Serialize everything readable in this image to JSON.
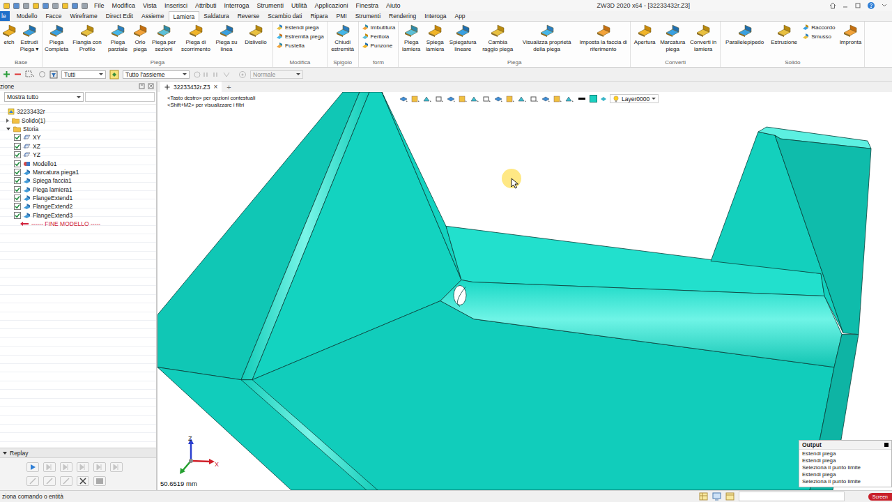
{
  "window": {
    "title": "ZW3D 2020 x64 - [32233432r.Z3]"
  },
  "menu": [
    "File",
    "Modifica",
    "Vista",
    "Inserisci",
    "Attributi",
    "Interroga",
    "Strumenti",
    "Utilità",
    "Applicazioni",
    "Finestra",
    "Aiuto"
  ],
  "ribbon_tabs": [
    {
      "label": "le",
      "kind": "file",
      "selected": false
    },
    {
      "label": "Modello",
      "kind": "tab",
      "selected": false
    },
    {
      "label": "Facce",
      "kind": "tab",
      "selected": false
    },
    {
      "label": "Wireframe",
      "kind": "tab",
      "selected": false
    },
    {
      "label": "Direct Edit",
      "kind": "tab",
      "selected": false
    },
    {
      "label": "Assieme",
      "kind": "tab",
      "selected": false
    },
    {
      "label": "Lamiera",
      "kind": "tab",
      "selected": true
    },
    {
      "label": "Saldatura",
      "kind": "tab",
      "selected": false
    },
    {
      "label": "Reverse",
      "kind": "tab",
      "selected": false
    },
    {
      "label": "Scambio dati",
      "kind": "tab",
      "selected": false
    },
    {
      "label": "Ripara",
      "kind": "tab",
      "selected": false
    },
    {
      "label": "PMI",
      "kind": "tab",
      "selected": false
    },
    {
      "label": "Strumenti",
      "kind": "tab",
      "selected": false
    },
    {
      "label": "Rendering",
      "kind": "tab",
      "selected": false
    },
    {
      "label": "Interoga",
      "kind": "tab",
      "selected": false
    },
    {
      "label": "App",
      "kind": "tab",
      "selected": false
    }
  ],
  "ribbon_groups": [
    {
      "label": "Base",
      "items": [
        {
          "label": "etch",
          "kind": "large"
        },
        {
          "label": "Estrudi Piega ▾",
          "kind": "large"
        }
      ]
    },
    {
      "label": "Piega",
      "items": [
        {
          "label": "Piega Completa",
          "kind": "large"
        },
        {
          "label": "Flangia con Profilo",
          "kind": "large"
        },
        {
          "label": "Piega parziale",
          "kind": "large"
        },
        {
          "label": "Orlo piega",
          "kind": "large"
        },
        {
          "label": "Piega per sezioni",
          "kind": "large"
        },
        {
          "label": "Piega di scorrimento",
          "kind": "large"
        },
        {
          "label": "Piega su linea",
          "kind": "large"
        },
        {
          "label": "Dislivello",
          "kind": "large"
        }
      ]
    },
    {
      "label": "Modifica",
      "items": [
        {
          "label": "Estendi piega",
          "kind": "small"
        },
        {
          "label": "Estremità piega",
          "kind": "small"
        },
        {
          "label": "Fustella",
          "kind": "small"
        }
      ]
    },
    {
      "label": "Spigolo",
      "items": [
        {
          "label": "Chiudi estremità",
          "kind": "large"
        }
      ]
    },
    {
      "label": "form",
      "items": [
        {
          "label": "Imbutitura",
          "kind": "small"
        },
        {
          "label": "Feritoia",
          "kind": "small"
        },
        {
          "label": "Punzone",
          "kind": "small"
        }
      ]
    },
    {
      "label": "Piega",
      "items": [
        {
          "label": "Piega lamiera",
          "kind": "large"
        },
        {
          "label": "Spiega lamiera",
          "kind": "large"
        },
        {
          "label": "Spiegatura lineare",
          "kind": "large"
        },
        {
          "label": "Cambia raggio piega",
          "kind": "large"
        },
        {
          "label": "Visualizza proprietà della piega",
          "kind": "large"
        },
        {
          "label": "Imposta la faccia di riferimento",
          "kind": "large"
        }
      ]
    },
    {
      "label": "Converti",
      "items": [
        {
          "label": "Apertura",
          "kind": "large"
        },
        {
          "label": "Marcatura piega",
          "kind": "large"
        },
        {
          "label": "Converti in lamiera",
          "kind": "large"
        }
      ]
    },
    {
      "label": "Solido",
      "items": [
        {
          "label": "Parallelepipedo",
          "kind": "large"
        },
        {
          "label": "Estrusione",
          "kind": "large"
        },
        {
          "label": "Raccordo",
          "kind": "small"
        },
        {
          "label": "Smusso",
          "kind": "small"
        },
        {
          "label": "Impronta",
          "kind": "large"
        }
      ]
    }
  ],
  "toolbar": {
    "filters": [
      {
        "label": "Tutti",
        "disabled": false
      },
      {
        "label": "Tutto l'assieme",
        "disabled": false
      },
      {
        "label": "Normale",
        "disabled": true
      }
    ]
  },
  "left_panel": {
    "title": "zione",
    "filter": "Mostra tutto",
    "tree": {
      "label": "32233432r",
      "children": [
        {
          "label": "Solido(1)",
          "kind": "folder",
          "expanded": false,
          "children": []
        },
        {
          "label": "Storia",
          "kind": "folder",
          "expanded": true,
          "children": [
            {
              "label": "XY",
              "kind": "plane",
              "checked": true
            },
            {
              "label": "XZ",
              "kind": "plane",
              "checked": true
            },
            {
              "label": "YZ",
              "kind": "plane",
              "checked": true
            },
            {
              "label": "Modello1",
              "kind": "model",
              "checked": true
            },
            {
              "label": "Marcatura piega1",
              "kind": "feature",
              "checked": true
            },
            {
              "label": "Spiega faccia1",
              "kind": "feature",
              "checked": true
            },
            {
              "label": "Piega lamiera1",
              "kind": "feature",
              "checked": true
            },
            {
              "label": "FlangeExtend1",
              "kind": "feature",
              "checked": true
            },
            {
              "label": "FlangeExtend2",
              "kind": "feature",
              "checked": true
            },
            {
              "label": "FlangeExtend3",
              "kind": "feature",
              "checked": true
            },
            {
              "label": "------ FINE MODELLO -----",
              "kind": "end",
              "checked": false
            }
          ]
        }
      ]
    }
  },
  "replay": {
    "title": "Replay"
  },
  "document_tabs": [
    {
      "label": "32233432r.Z3",
      "selected": true,
      "close": "×"
    }
  ],
  "new_tab": "+",
  "viewport": {
    "hints": [
      "<Tasto destro> per opzioni contestuali",
      "<Shift+M2> per visualizzare i filtri"
    ],
    "layer": "Layer0000",
    "scale": "50.6519 mm",
    "axes": {
      "z": "Z",
      "x": "X"
    }
  },
  "output": {
    "title": "Output",
    "lines": [
      "Estendi piega",
      "Estendi piega",
      "Seleziona il punto limite",
      "Estendi piega",
      "Seleziona il punto limite"
    ]
  },
  "status_bar": {
    "prompt": "ziona comando o entità"
  },
  "watermark": "Screen"
}
